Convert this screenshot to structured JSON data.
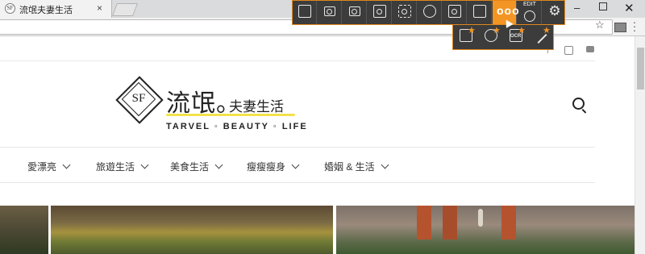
{
  "browser": {
    "tab_title": "流氓夫妻生活",
    "tab_favicon": "SF",
    "tab_close": "×",
    "window_min": "–",
    "window_close": "✕",
    "bookmark_star": "☆"
  },
  "site": {
    "logo_mark": "SF",
    "logo_main": "流氓。",
    "logo_sub": "夫妻生活",
    "tagline": "TARVEL ◦ BEAUTY ◦ LIFE",
    "nav": [
      {
        "label": "愛漂亮"
      },
      {
        "label": "旅遊生活"
      },
      {
        "label": "美食生活"
      },
      {
        "label": "瘦瘦瘦身"
      },
      {
        "label": "婚姻 & 生活"
      }
    ]
  },
  "toolbar": {
    "buttons": [
      {
        "icon": "video-capture-icon"
      },
      {
        "icon": "camera-icon"
      },
      {
        "icon": "camera-www-icon"
      },
      {
        "icon": "window-capture-icon"
      },
      {
        "icon": "region-capture-icon"
      },
      {
        "icon": "cloud-upload-icon"
      },
      {
        "icon": "browser-capture-icon"
      },
      {
        "icon": "document-icon"
      },
      {
        "icon": "more-icon"
      },
      {
        "icon": "edit-check-icon"
      },
      {
        "icon": "gear-icon"
      }
    ],
    "more_label": "ooo",
    "edit_label": "EDIT",
    "gear_glyph": "⚙",
    "submenu": [
      {
        "icon": "window-star-icon"
      },
      {
        "icon": "timer-star-icon"
      },
      {
        "icon": "ocr-star-icon"
      },
      {
        "icon": "pen-star-icon"
      }
    ],
    "ocr_text": "OCR",
    "star_glyph": "★",
    "accent_color": "#f39524"
  }
}
